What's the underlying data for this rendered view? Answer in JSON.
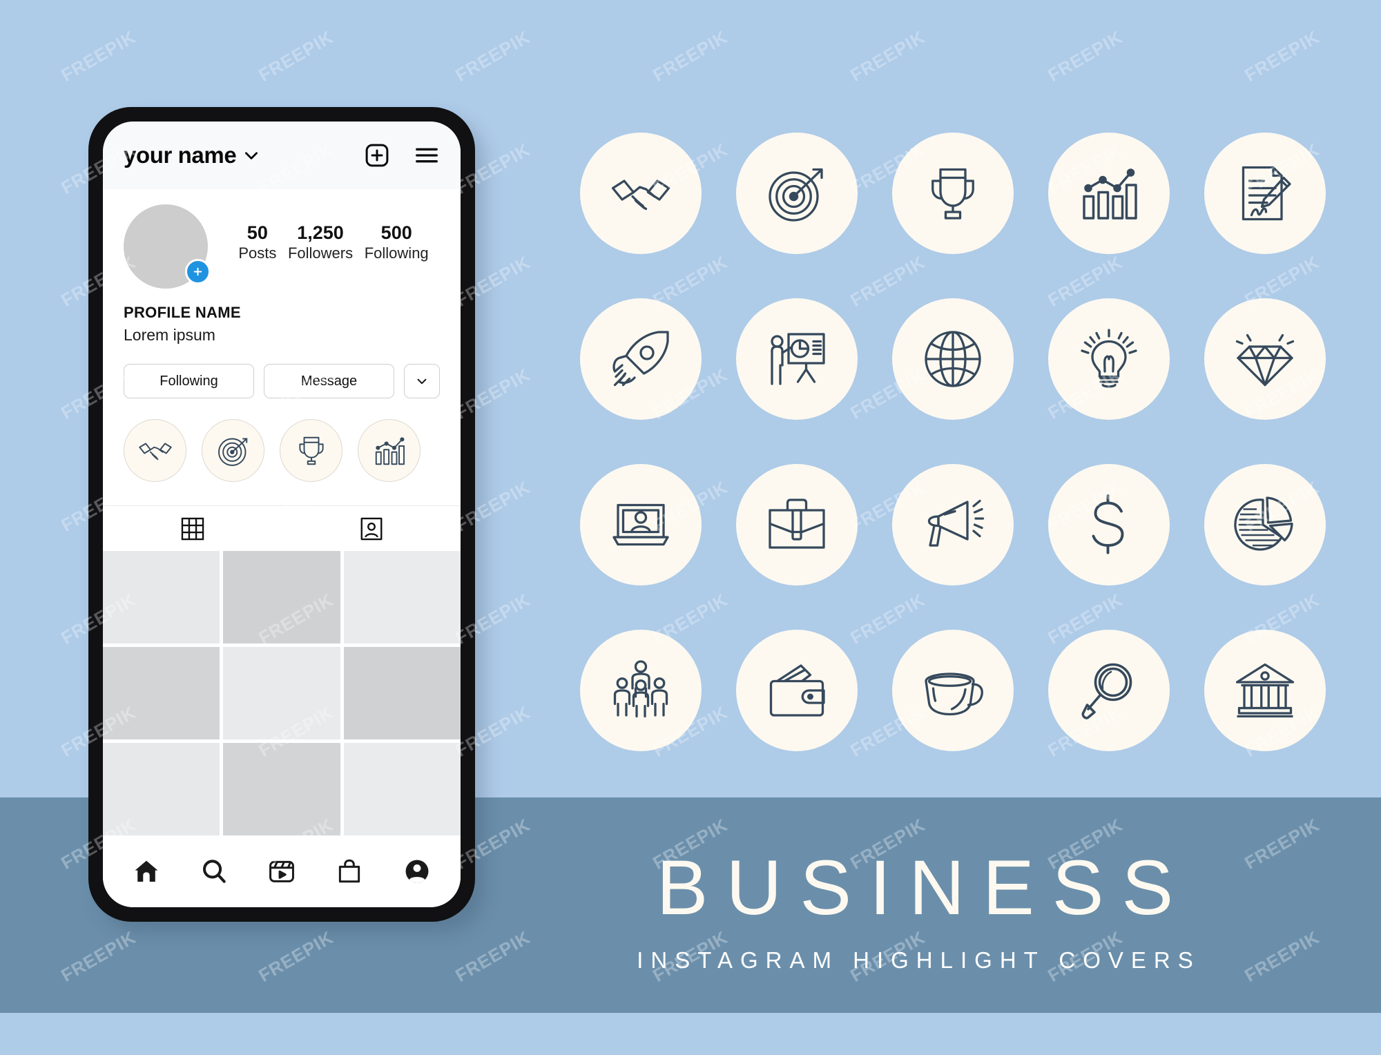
{
  "colors": {
    "bg_top": "#aecbe8",
    "bg_bottom": "#6b8fab",
    "cover_fill": "#fdf9f0",
    "icon_stroke": "#36495c",
    "accent_blue": "#1f93e0",
    "phone_frame": "#111113"
  },
  "phone": {
    "header": {
      "username": "your name",
      "chevron_icon": "chevron-down-icon",
      "add_icon": "add-post-icon",
      "menu_icon": "hamburger-menu-icon"
    },
    "profile": {
      "avatar_icon": "avatar-placeholder",
      "add_story_icon": "plus-icon",
      "stats": [
        {
          "value": "50",
          "label": "Posts"
        },
        {
          "value": "1,250",
          "label": "Followers"
        },
        {
          "value": "500",
          "label": "Following"
        }
      ],
      "display_name": "PROFILE NAME",
      "bio": "Lorem ipsum"
    },
    "actions": {
      "following_label": "Following",
      "message_label": "Message",
      "more_icon": "chevron-down-icon"
    },
    "highlights": [
      {
        "name": "handshake",
        "icon": "handshake-icon"
      },
      {
        "name": "target",
        "icon": "target-dart-icon"
      },
      {
        "name": "trophy",
        "icon": "trophy-icon"
      },
      {
        "name": "growth chart",
        "icon": "bar-chart-growth-icon"
      }
    ],
    "content_tabs": [
      {
        "name": "grid",
        "icon": "grid-tab-icon",
        "active": true
      },
      {
        "name": "tagged",
        "icon": "tagged-tab-icon",
        "active": false
      }
    ],
    "grid_cells": [
      "#e6e8ea",
      "#cfd1d3",
      "#e9ebed",
      "#d2d4d6",
      "#e8eaec",
      "#cfd1d3",
      "#e6e8ea",
      "#d2d4d6",
      "#e9ebed"
    ],
    "bottom_nav": [
      {
        "name": "home",
        "icon": "home-icon"
      },
      {
        "name": "search",
        "icon": "search-icon"
      },
      {
        "name": "reels",
        "icon": "reels-icon"
      },
      {
        "name": "shop",
        "icon": "shop-bag-icon"
      },
      {
        "name": "profile",
        "icon": "profile-avatar-icon"
      }
    ]
  },
  "icon_board": {
    "rows": 4,
    "columns": 5,
    "covers": [
      {
        "label": "handshake",
        "icon": "handshake-icon"
      },
      {
        "label": "target",
        "icon": "target-dart-icon"
      },
      {
        "label": "trophy",
        "icon": "trophy-icon"
      },
      {
        "label": "growth chart",
        "icon": "bar-chart-growth-icon"
      },
      {
        "label": "contract signing",
        "icon": "contract-signature-icon"
      },
      {
        "label": "rocket",
        "icon": "rocket-icon"
      },
      {
        "label": "presentation",
        "icon": "presentation-person-icon"
      },
      {
        "label": "globe",
        "icon": "globe-icon"
      },
      {
        "label": "idea lightbulb",
        "icon": "lightbulb-icon"
      },
      {
        "label": "diamond",
        "icon": "diamond-icon"
      },
      {
        "label": "webinar laptop",
        "icon": "laptop-person-icon"
      },
      {
        "label": "briefcase",
        "icon": "briefcase-icon"
      },
      {
        "label": "megaphone",
        "icon": "megaphone-icon"
      },
      {
        "label": "dollar",
        "icon": "dollar-sign-icon"
      },
      {
        "label": "pie chart",
        "icon": "pie-chart-icon"
      },
      {
        "label": "team",
        "icon": "team-group-icon"
      },
      {
        "label": "wallet",
        "icon": "wallet-icon"
      },
      {
        "label": "coffee cup",
        "icon": "coffee-cup-icon"
      },
      {
        "label": "magnifier",
        "icon": "magnifier-icon"
      },
      {
        "label": "bank",
        "icon": "bank-building-icon"
      }
    ]
  },
  "title_block": {
    "title": "BUSINESS",
    "subtitle": "INSTAGRAM HIGHLIGHT COVERS"
  },
  "watermark": {
    "text": "FREEPIK",
    "repeat": 63
  }
}
